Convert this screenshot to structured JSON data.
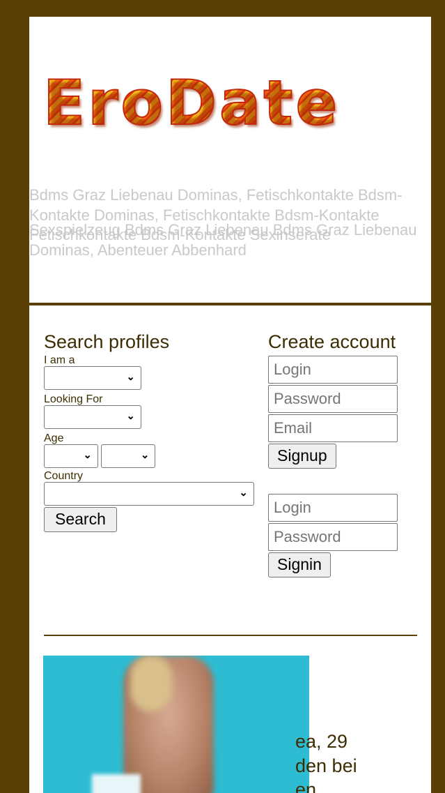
{
  "brand": {
    "logo_text": "EroDate"
  },
  "header": {
    "tagline_1": "Bdms Graz Liebenau Dominas, Fetischkontakte Bdsm-Kontakte Dominas, Fetischkontakte Bdsm-Kontakte Fetischkontakte Bdsm-Kontakte Sexinserate",
    "tagline_2": "Sexspielzeug Bdms Graz Liebenau Bdms Graz Liebenau Dominas, Abenteuer Abbenhard"
  },
  "search": {
    "title": "Search profiles",
    "i_am_label": "I am a",
    "looking_for_label": "Looking For",
    "age_label": "Age",
    "country_label": "Country",
    "i_am_value": "",
    "looking_for_value": "",
    "age_from_value": "",
    "age_to_value": "",
    "country_value": "",
    "button": "Search"
  },
  "signup": {
    "title": "Create account",
    "login_placeholder": "Login",
    "password_placeholder": "Password",
    "email_placeholder": "Email",
    "button": "Signup"
  },
  "signin": {
    "login_placeholder": "Login",
    "password_placeholder": "Password",
    "button": "Signin"
  },
  "profile": {
    "line1": "ea, 29",
    "line2": "den bei",
    "line3": "en"
  }
}
